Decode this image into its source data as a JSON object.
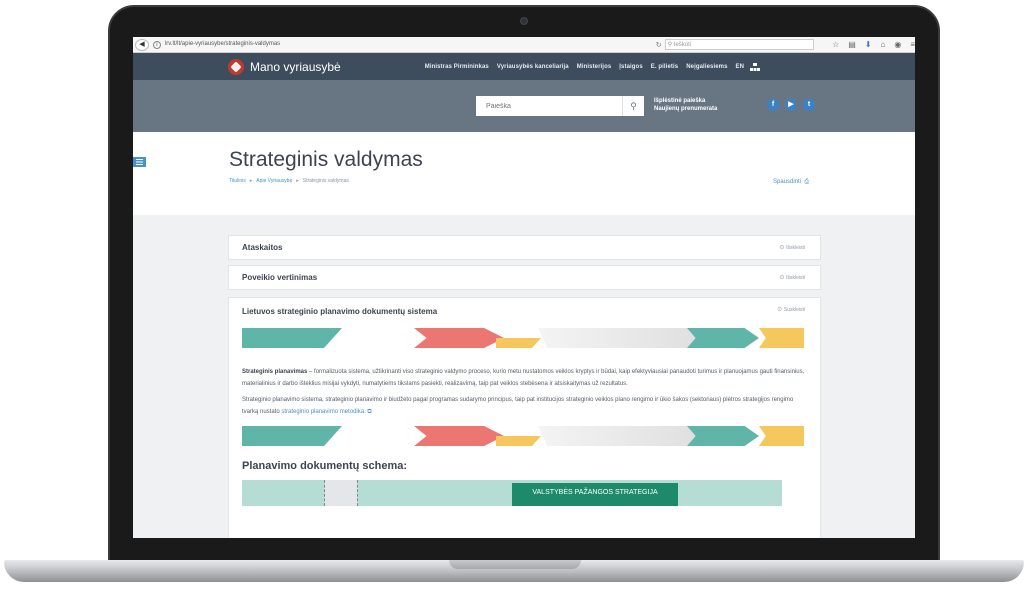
{
  "browser": {
    "url": "lrv.lt/lt/apie-vyriausybe/strateginis-valdymas",
    "search_placeholder": "Ieškoti"
  },
  "site": {
    "title": "Mano vyriausybė",
    "nav": [
      "Ministras Pirmininkas",
      "Vyriausybės kanceliarija",
      "Ministerijos",
      "Įstaigos",
      "E. pilietis",
      "Neįgaliesiems",
      "EN"
    ]
  },
  "search": {
    "placeholder": "Paieška",
    "advanced_label": "Išplėstinė paieška",
    "newsletter_label": "Naujienų prenumerata"
  },
  "social": [
    "f",
    "▶",
    "t"
  ],
  "page": {
    "title": "Strateginis valdymas",
    "breadcrumb": [
      "Titulinis",
      "Apie Vyriausybę",
      "Strateginis valdymas"
    ],
    "print_label": "Spausdinti"
  },
  "accordion": [
    {
      "title": "Ataskaitos",
      "toggle": "Išskleisti"
    },
    {
      "title": "Poveikio vertinimas",
      "toggle": "Išskleisti"
    },
    {
      "title": "Lietuvos strateginio planavimo dokumentų sistema",
      "toggle": "Suskleisti"
    }
  ],
  "body": {
    "p1_term": "Strateginis planavimas",
    "p1_text": " – formalizuota sistema, užtikrinanti viso strateginio valdymo proceso, kurio metu nustatomos veiklos kryptys ir būdai, kaip efektyviausiai panaudoti turimus ir planuojamus gauti finansinius, materialinius ir darbo išteklius misijai vykdyti, numatytiems tikslams pasiekti, realizavimą, taip pat veiklos stebėsena ir atsiskaitymas už rezultatus.",
    "p2_text": "Strateginio planavimo sistema, strateginio planavimo ir biudžeto pagal programas sudarymo principus, taip pat institucijos strateginio veiklos plano rengimo ir ūkio šakos (sektoriaus) plėtros strategijos rengimo tvarką nustato ",
    "p2_link": "strateginio planavimo metodika.",
    "schema_heading": "Planavimo dokumentų schema:",
    "schema_box": "VALSTYBĖS PAŽANGOS STRATEGIJA"
  },
  "colors": {
    "header": "#3d4d5e",
    "search_band": "#687684",
    "accent": "#4a90c8",
    "teal": "#5fb5a8",
    "red": "#ec7671",
    "yellow": "#f6c75d",
    "schema_box": "#1e8a6c"
  }
}
